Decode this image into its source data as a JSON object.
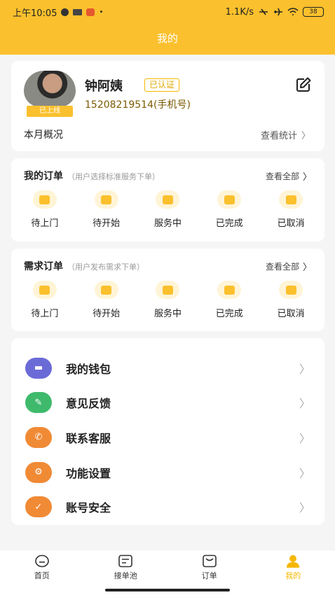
{
  "status": {
    "time": "上午10:05",
    "network": "1.1K/s",
    "battery": "38"
  },
  "header": {
    "title": "我的"
  },
  "profile": {
    "online_badge": "已上线",
    "name": "钟阿姨",
    "verified": "已认证",
    "phone": "15208219514(手机号)",
    "month_label": "本月概况",
    "stats_link": "查看统计"
  },
  "my_orders": {
    "title": "我的订单",
    "subtitle": "（用户选择标准服务下单）",
    "view_all": "查看全部",
    "items": [
      {
        "label": "待上门"
      },
      {
        "label": "待开始"
      },
      {
        "label": "服务中"
      },
      {
        "label": "已完成"
      },
      {
        "label": "已取消"
      }
    ]
  },
  "demand_orders": {
    "title": "需求订单",
    "subtitle": "（用户发布需求下单）",
    "view_all": "查看全部",
    "items": [
      {
        "label": "待上门"
      },
      {
        "label": "待开始"
      },
      {
        "label": "服务中"
      },
      {
        "label": "已完成"
      },
      {
        "label": "已取消"
      }
    ]
  },
  "menu": [
    {
      "label": "我的钱包",
      "icon": "wallet-icon",
      "color": "#6b6bd8"
    },
    {
      "label": "意见反馈",
      "icon": "feedback-icon",
      "color": "#3fba6c"
    },
    {
      "label": "联系客服",
      "icon": "phone-icon",
      "color": "#f08a35"
    },
    {
      "label": "功能设置",
      "icon": "gear-icon",
      "color": "#f08a35"
    },
    {
      "label": "账号安全",
      "icon": "shield-icon",
      "color": "#f08a35"
    }
  ],
  "tabs": [
    {
      "label": "首页",
      "icon": "home-icon"
    },
    {
      "label": "接单池",
      "icon": "order-pool-icon"
    },
    {
      "label": "订单",
      "icon": "orders-icon"
    },
    {
      "label": "我的",
      "icon": "profile-icon"
    }
  ],
  "colors": {
    "accent": "#fbc02d",
    "background": "#f5f5f5"
  }
}
